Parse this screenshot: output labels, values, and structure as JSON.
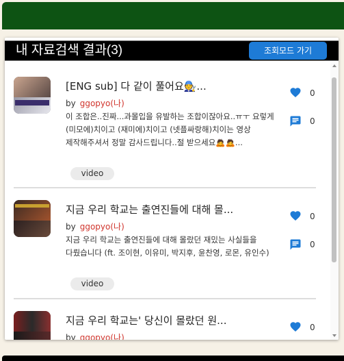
{
  "header": {
    "title": "내 자료검색 결과(3)",
    "view_mode_button": "조회모드 가기"
  },
  "results": [
    {
      "title": "[ENG sub] 다 같이 풀어요🧑‍🔧...",
      "by_label": "by",
      "author": "ggopyo(나)",
      "description": "이 조합은..진짜...과몰입을 유발하는 조합이잖아요..ㅠㅜ 요렇게 (미모에)치이고 (재미에)치이고 (넷플싸랑해)치이는 영상 제작해주셔서 정말 감사드립니다..절 받으세요🙇🙇...",
      "tag": "video",
      "likes": "0",
      "comments": "0"
    },
    {
      "title": "지금 우리 학교는 출연진들에 대해 몰...",
      "by_label": "by",
      "author": "ggopyo(나)",
      "description": "지금 우리 학교는 출연진들에 대해 몰랐던 재밌는 사실들을 다뤘습니다 (ft. 조이현, 이유미, 박지후, 윤찬영, 로몬, 유인수)",
      "tag": "video",
      "likes": "0",
      "comments": "0"
    },
    {
      "title": "지금 우리 학교는' 당신이 몰랐던 원...",
      "by_label": "by",
      "author": "ggopyo(나)",
      "likes": "0"
    }
  ],
  "colors": {
    "accent": "#1e7bd6",
    "brand_bar": "#0d5313",
    "author": "#d0342c"
  },
  "icons": {
    "like": "heart-icon",
    "comment": "comment-icon"
  }
}
